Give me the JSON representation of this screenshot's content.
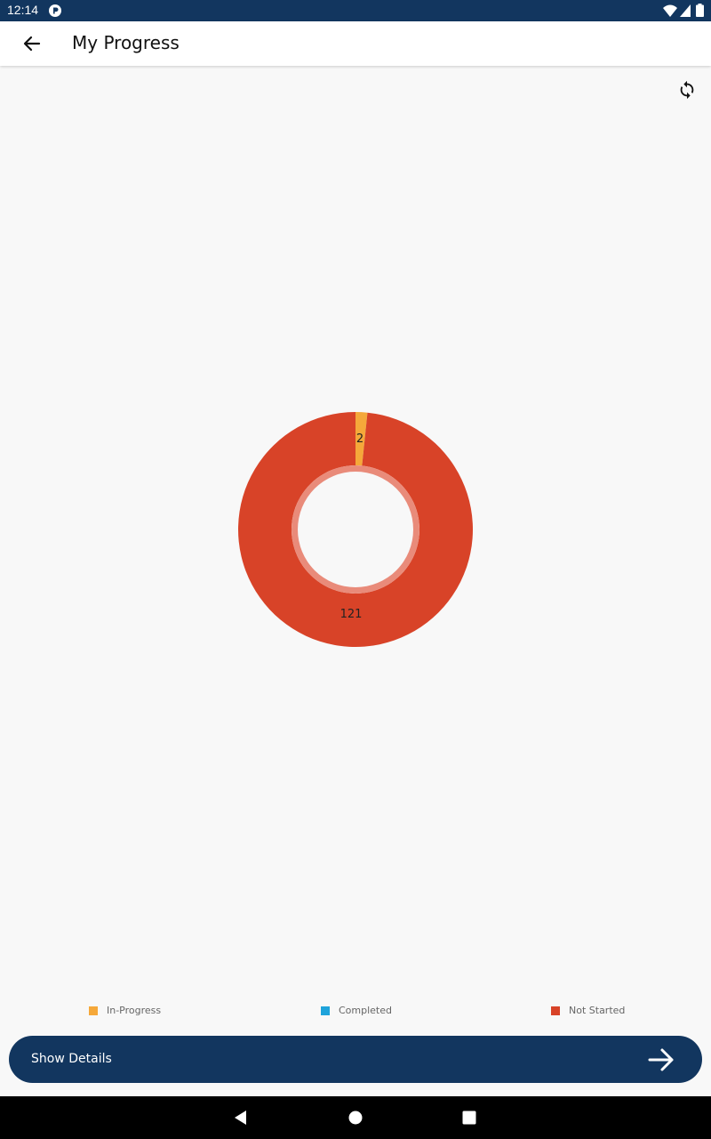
{
  "status_bar": {
    "time": "12:14",
    "icons": [
      "app-notification-icon",
      "wifi-icon",
      "signal-icon",
      "battery-icon"
    ]
  },
  "app_bar": {
    "title": "My Progress",
    "back_icon": "arrow-back-icon"
  },
  "toolbar": {
    "refresh_icon": "refresh-icon"
  },
  "chart_data": {
    "type": "pie",
    "donut": true,
    "slices": [
      {
        "label": "In-Progress",
        "value": 2,
        "color": "#f5a83a"
      },
      {
        "label": "Completed",
        "value": 0,
        "color": "#1fa3db"
      },
      {
        "label": "Not Started",
        "value": 121,
        "color": "#d84328"
      }
    ],
    "data_labels": [
      "2",
      "121"
    ],
    "legend": [
      "In-Progress",
      "Completed",
      "Not Started"
    ],
    "legend_position": "bottom"
  },
  "actions": {
    "show_details_label": "Show Details",
    "show_details_icon": "arrow-forward-icon"
  },
  "nav_bar": {
    "buttons": [
      "nav-back-icon",
      "nav-home-icon",
      "nav-recents-icon"
    ]
  },
  "colors": {
    "primary": "#12365f",
    "background": "#f8f8f8",
    "in_progress": "#f5a83a",
    "completed": "#1fa3db",
    "not_started": "#d84328"
  }
}
